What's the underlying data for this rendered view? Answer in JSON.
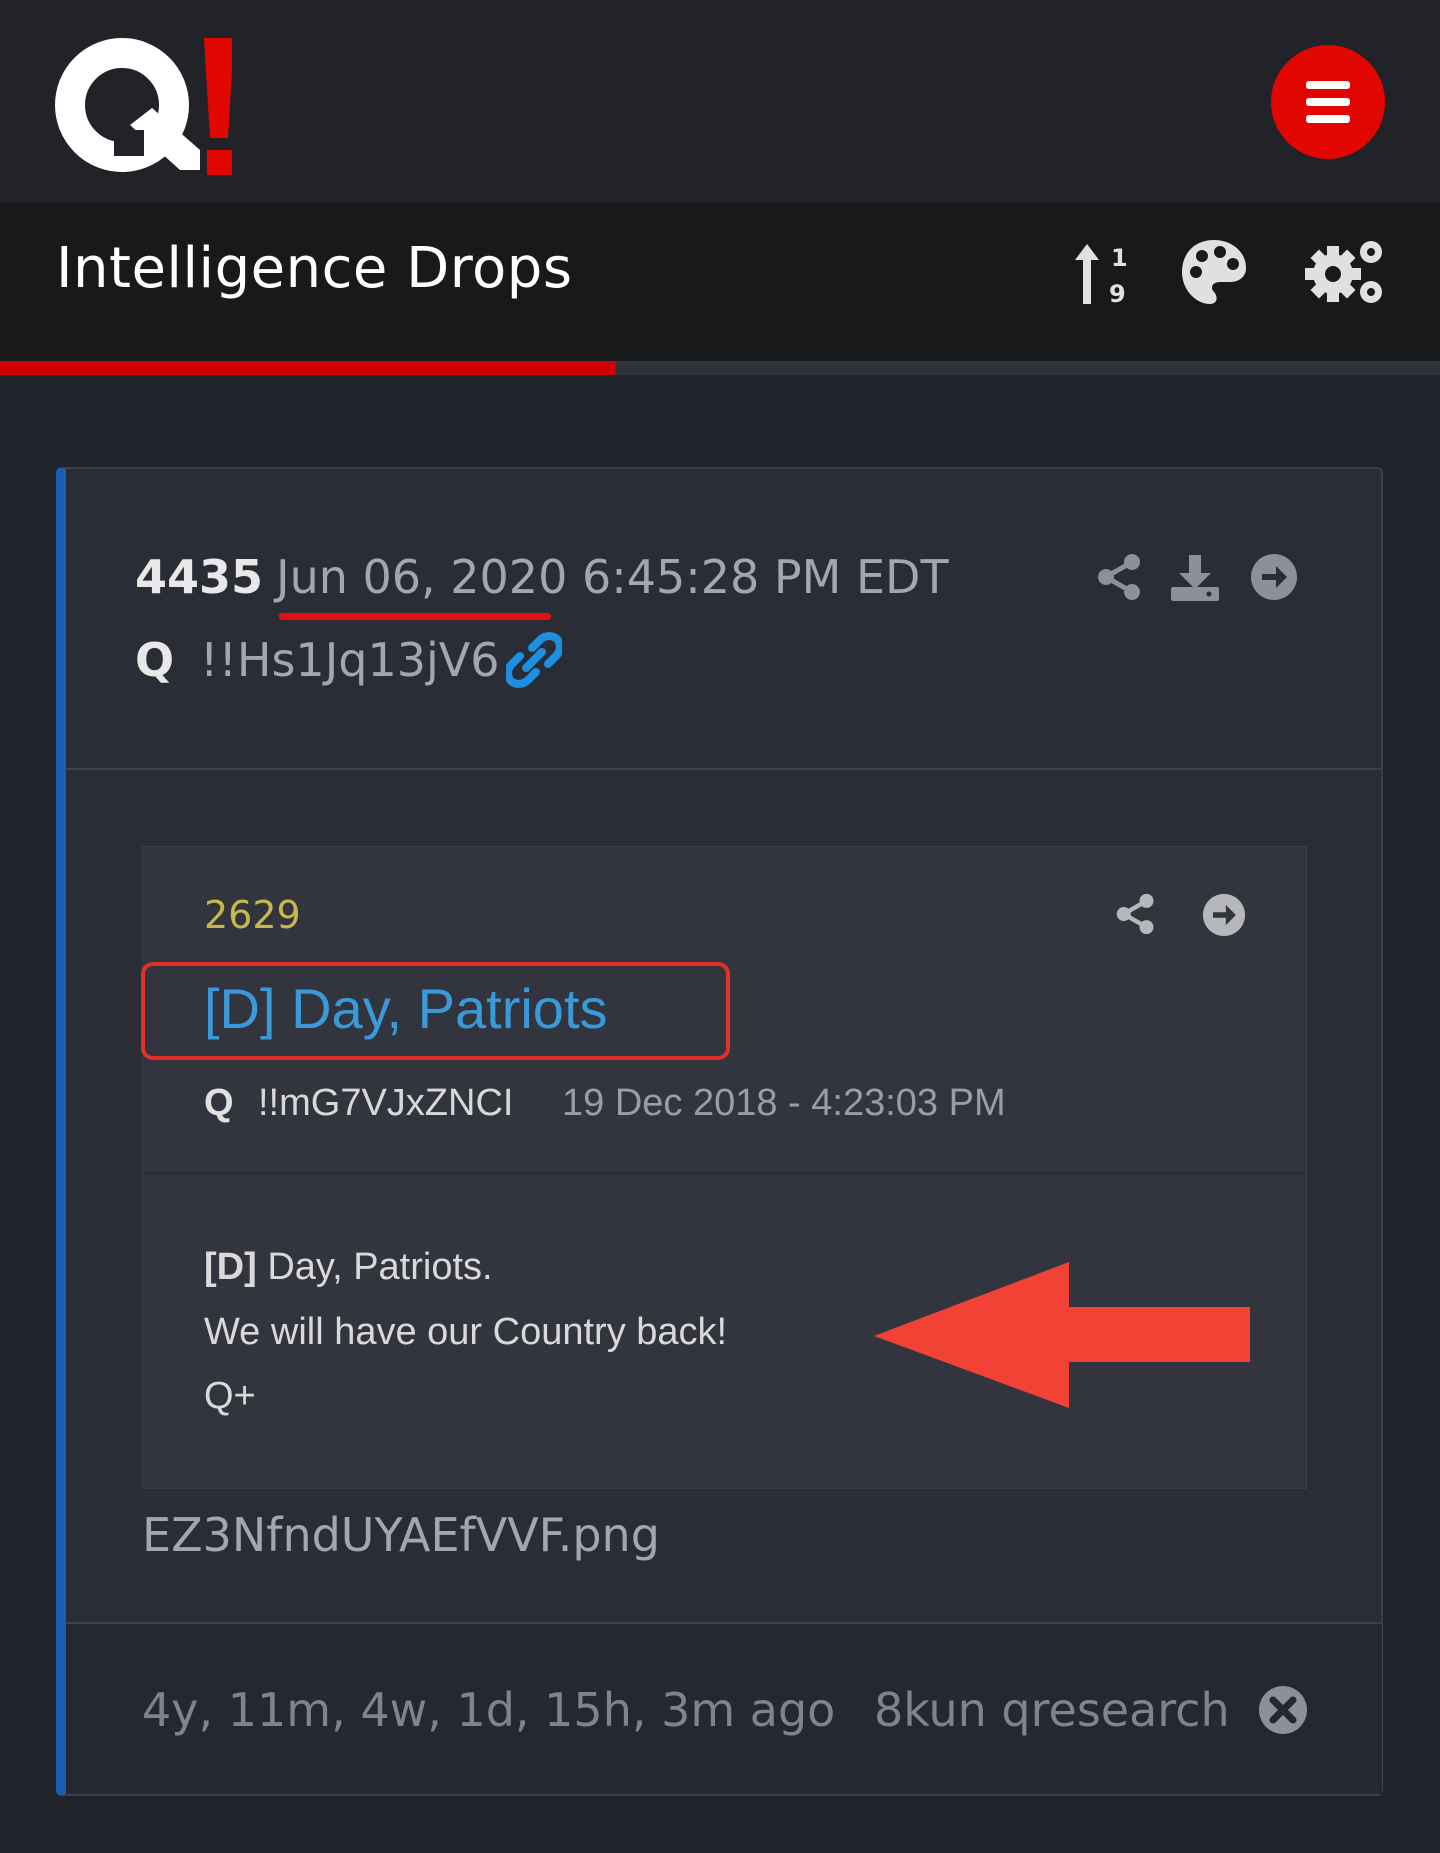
{
  "header": {
    "logo_text": "Q!",
    "menu_icon": "hamburger-icon",
    "brand_colors": {
      "red": "#e10600",
      "blue_accent": "#1b5fb4"
    }
  },
  "toolbar": {
    "title": "Intelligence Drops",
    "icons": [
      "sort-numeric-icon",
      "palette-icon",
      "settings-icon"
    ],
    "progress_fraction": 0.428
  },
  "drop": {
    "number": "4435",
    "date": "Jun 06, 2020 6:45:28 PM EDT",
    "author": "Q",
    "tripcode": "!!Hs1Jq13jV6",
    "action_icons": [
      "share-icon",
      "download-icon",
      "arrow-right-icon"
    ],
    "embedded": {
      "number": "2629",
      "title": "[D] Day, Patriots",
      "author": "Q",
      "tripcode": "!!mG7VJxZNCI",
      "timestamp": "19 Dec 2018 - 4:23:03 PM",
      "body_bold": "[D]",
      "body_lines": [
        "Day, Patriots.",
        "We will have our Country back!",
        "Q+"
      ]
    },
    "filename": "EZ3NfndUYAEfVVF.png",
    "elapsed": "4y, 11m, 4w, 1d, 15h, 3m ago",
    "source": "8kun qresearch"
  }
}
